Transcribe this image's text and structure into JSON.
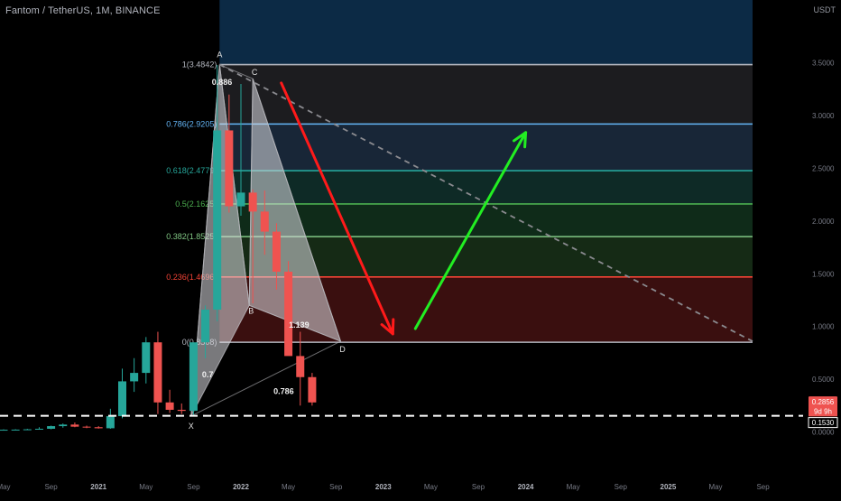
{
  "header": {
    "symbol_title": "Fantom / TetherUS, 1M, BINANCE",
    "currency": "USDT"
  },
  "chart_data": {
    "type": "candlestick",
    "title": "Fantom / TetherUS, 1M, BINANCE",
    "y_axis_unit": "USDT",
    "ylim": [
      0,
      3.9
    ],
    "y_ticks": [
      "0.0000",
      "0.5000",
      "1.0000",
      "1.5000",
      "2.0000",
      "2.5000",
      "3.0000",
      "3.5000"
    ],
    "x_ticks": [
      "May",
      "Sep",
      "2021",
      "May",
      "Sep",
      "2022",
      "May",
      "Sep",
      "2023",
      "May",
      "Sep",
      "2024",
      "May",
      "Sep",
      "2025",
      "May",
      "Sep"
    ],
    "colors": {
      "up": "#26a69a",
      "down": "#ef5350",
      "fib_top": "#b2b5be",
      "fib_786": "#64b5f6",
      "fib_618": "#26a69a",
      "fib_5": "#4caf50",
      "fib_382": "#81c784",
      "fib_236": "#f44336",
      "fib_0": "#b2b5be",
      "arrow_down": "#ff1a1a",
      "arrow_up": "#22ee22",
      "price_badge": "#ef5350"
    },
    "candles": [
      {
        "t": 0,
        "o": 0.02,
        "h": 0.025,
        "l": 0.017,
        "c": 0.021
      },
      {
        "t": 1,
        "o": 0.021,
        "h": 0.026,
        "l": 0.018,
        "c": 0.022
      },
      {
        "t": 2,
        "o": 0.022,
        "h": 0.03,
        "l": 0.019,
        "c": 0.025
      },
      {
        "t": 3,
        "o": 0.025,
        "h": 0.045,
        "l": 0.022,
        "c": 0.03
      },
      {
        "t": 4,
        "o": 0.03,
        "h": 0.06,
        "l": 0.025,
        "c": 0.055
      },
      {
        "t": 5,
        "o": 0.055,
        "h": 0.08,
        "l": 0.04,
        "c": 0.07
      },
      {
        "t": 6,
        "o": 0.07,
        "h": 0.09,
        "l": 0.045,
        "c": 0.05
      },
      {
        "t": 7,
        "o": 0.05,
        "h": 0.06,
        "l": 0.036,
        "c": 0.045
      },
      {
        "t": 8,
        "o": 0.045,
        "h": 0.055,
        "l": 0.032,
        "c": 0.035
      },
      {
        "t": 9,
        "o": 0.035,
        "h": 0.22,
        "l": 0.03,
        "c": 0.15
      },
      {
        "t": 10,
        "o": 0.15,
        "h": 0.6,
        "l": 0.13,
        "c": 0.48
      },
      {
        "t": 11,
        "o": 0.48,
        "h": 0.7,
        "l": 0.38,
        "c": 0.56
      },
      {
        "t": 12,
        "o": 0.56,
        "h": 0.9,
        "l": 0.46,
        "c": 0.85
      },
      {
        "t": 13,
        "o": 0.85,
        "h": 0.95,
        "l": 0.17,
        "c": 0.28
      },
      {
        "t": 14,
        "o": 0.28,
        "h": 0.4,
        "l": 0.18,
        "c": 0.21
      },
      {
        "t": 15,
        "o": 0.21,
        "h": 0.27,
        "l": 0.17,
        "c": 0.2
      },
      {
        "t": 16,
        "o": 0.2,
        "h": 0.82,
        "l": 0.16,
        "c": 0.85
      },
      {
        "t": 17,
        "o": 0.85,
        "h": 1.2,
        "l": 0.7,
        "c": 1.16
      },
      {
        "t": 18,
        "o": 1.16,
        "h": 3.48,
        "l": 1.05,
        "c": 2.86
      },
      {
        "t": 19,
        "o": 2.86,
        "h": 3.2,
        "l": 2.08,
        "c": 2.14
      },
      {
        "t": 20,
        "o": 2.14,
        "h": 3.3,
        "l": 2.05,
        "c": 2.27
      },
      {
        "t": 21,
        "o": 2.27,
        "h": 2.3,
        "l": 1.22,
        "c": 2.09
      },
      {
        "t": 22,
        "o": 2.09,
        "h": 2.29,
        "l": 1.68,
        "c": 1.9
      },
      {
        "t": 23,
        "o": 1.9,
        "h": 1.98,
        "l": 1.35,
        "c": 1.52
      },
      {
        "t": 24,
        "o": 1.52,
        "h": 1.62,
        "l": 0.82,
        "c": 0.72
      },
      {
        "t": 25,
        "o": 0.72,
        "h": 0.95,
        "l": 0.25,
        "c": 0.52
      },
      {
        "t": 26,
        "o": 0.52,
        "h": 0.56,
        "l": 0.25,
        "c": 0.28
      }
    ],
    "x_index_2021": 8,
    "harmonic_pattern": {
      "points": [
        {
          "label": "X",
          "t": 15.8,
          "price": 0.15
        },
        {
          "label": "A",
          "t": 18.2,
          "price": 3.484
        },
        {
          "label": "B",
          "t": 20.7,
          "price": 1.2
        },
        {
          "label": "C",
          "t": 21.0,
          "price": 3.35
        },
        {
          "label": "D",
          "t": 28.4,
          "price": 0.86
        }
      ],
      "ratios": [
        {
          "text": "0.886",
          "t": 18.4,
          "price": 3.29
        },
        {
          "text": "0.7",
          "t": 17.2,
          "price": 0.52
        },
        {
          "text": "0.786",
          "t": 23.6,
          "price": 0.36
        },
        {
          "text": "1.139",
          "t": 24.9,
          "price": 0.99
        }
      ]
    },
    "fibonacci": {
      "t_start": 18.2,
      "t_end": 64,
      "levels": [
        {
          "label": "1(3.4842)",
          "price": 3.4842,
          "key": "fib_top"
        },
        {
          "label": "0.786(2.9205)",
          "price": 2.9205,
          "key": "fib_786"
        },
        {
          "label": "0.618(2.4779)",
          "price": 2.4779,
          "key": "fib_618"
        },
        {
          "label": "0.5(2.1625)",
          "price": 2.1625,
          "key": "fib_5"
        },
        {
          "label": "0.382(1.8525)",
          "price": 1.8525,
          "key": "fib_382"
        },
        {
          "label": "0.236(1.4696)",
          "price": 1.4696,
          "key": "fib_236"
        },
        {
          "label": "0(0.8508)",
          "price": 0.8508,
          "key": "fib_0"
        }
      ]
    },
    "trendline": {
      "t1": 18.2,
      "p1": 3.484,
      "t2": 64,
      "p2": 0.86
    },
    "arrows": [
      {
        "direction": "down",
        "t1": 23.4,
        "p1": 3.31,
        "t2": 32.8,
        "p2": 0.93
      },
      {
        "direction": "up",
        "t1": 34.7,
        "p1": 0.98,
        "t2": 44.0,
        "p2": 2.84
      }
    ],
    "horizontal_dashed": {
      "price": 0.153
    },
    "price_labels": [
      {
        "text": "0.2856",
        "price": 0.2856,
        "style": "badge"
      },
      {
        "text": "9d 9h",
        "price": 0.19,
        "style": "countdown"
      },
      {
        "text": "0.1530",
        "price": 0.153,
        "style": "outline"
      }
    ]
  }
}
